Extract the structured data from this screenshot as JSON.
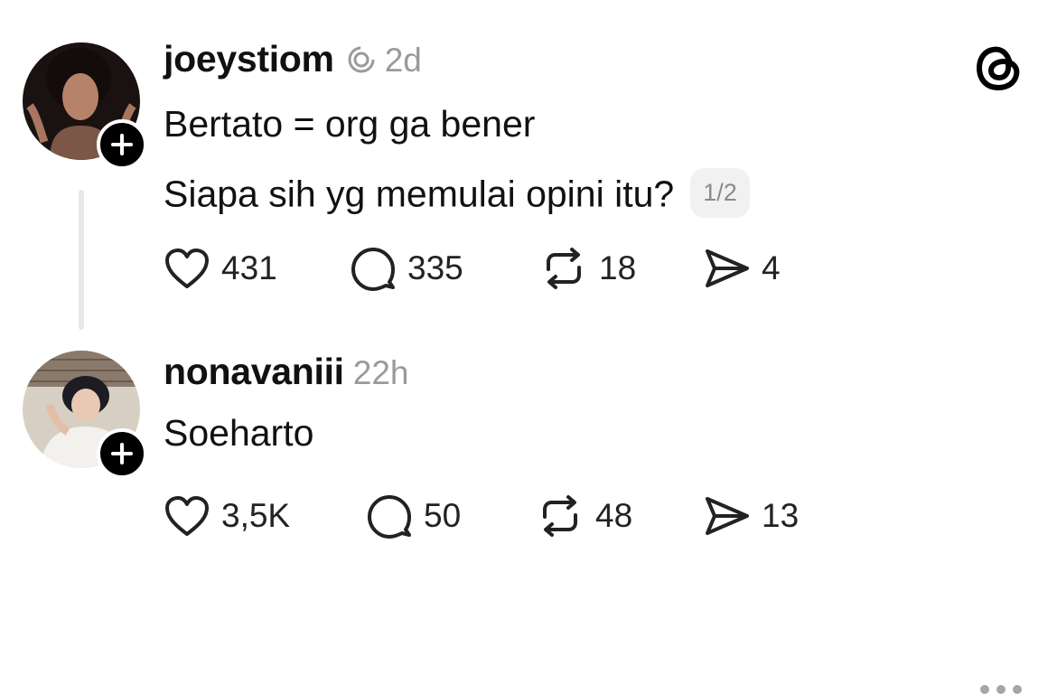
{
  "posts": [
    {
      "username": "joeystiom",
      "timestamp": "2d",
      "lines": [
        "Bertato = org ga bener",
        "Siapa sih yg memulai opini itu?"
      ],
      "page_indicator": "1/2",
      "likes": "431",
      "replies": "335",
      "reposts": "18",
      "shares": "4"
    },
    {
      "username": "nonavaniii",
      "timestamp": "22h",
      "lines": [
        "Soeharto"
      ],
      "likes": "3,5K",
      "replies": "50",
      "reposts": "48",
      "shares": "13"
    }
  ],
  "icons": {
    "app_logo": "threads-logo-icon",
    "follow": "plus-icon",
    "op_indicator": "author-ring-icon",
    "like": "heart-icon",
    "reply": "comment-bubble-icon",
    "repost": "repost-icon",
    "share": "send-icon",
    "menu": "more-dots-icon"
  },
  "colors": {
    "text": "#111111",
    "muted": "#9a9a9a",
    "badge": "#000000"
  }
}
